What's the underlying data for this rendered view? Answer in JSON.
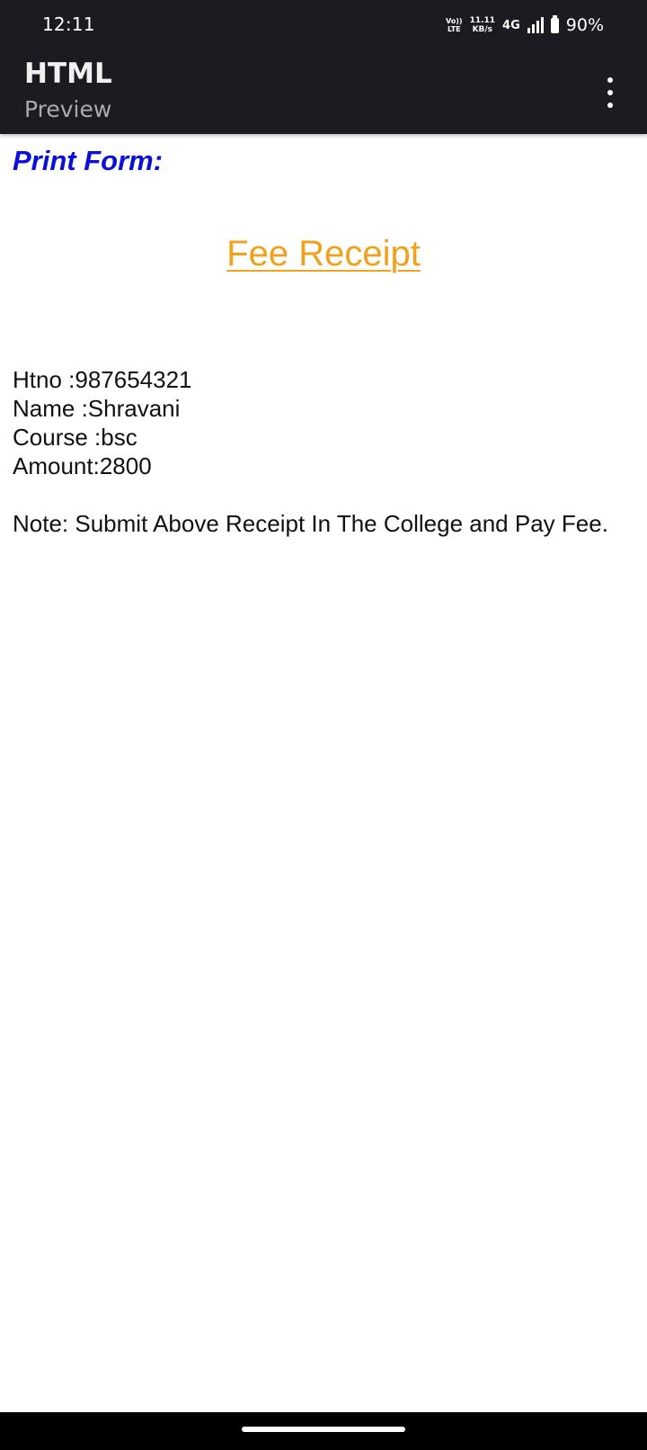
{
  "status_bar": {
    "time": "12:11",
    "volte_top": "Vo))",
    "volte_bottom": "LTE",
    "speed_value": "11.11",
    "speed_unit": "KB/s",
    "network": "4G",
    "battery": "90%",
    "icons": [
      "volte-icon",
      "signal-icon",
      "battery-icon"
    ]
  },
  "app_bar": {
    "title": "HTML",
    "subtitle": "Preview",
    "menu_icon": "more-vert-icon"
  },
  "content": {
    "heading": "Print Form:",
    "receipt_link": "Fee Receipt",
    "details": {
      "htno": "Htno :987654321",
      "name": "Name :Shravani",
      "course": "Course :bsc",
      "amount": "Amount:2800"
    },
    "note": "Note: Submit Above Receipt In The College and Pay Fee."
  },
  "colors": {
    "bar_background": "#1b1c21",
    "heading": "#0a10d8",
    "link": "#f0a21c",
    "text": "#111111"
  }
}
